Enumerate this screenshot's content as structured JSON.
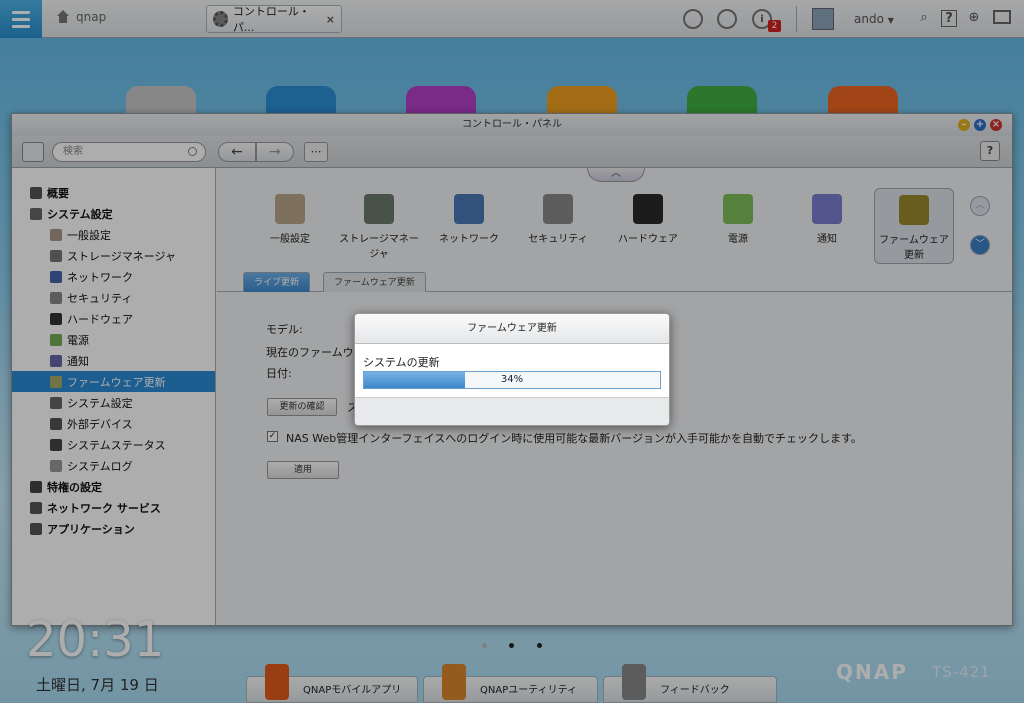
{
  "topbar": {
    "home_label": "qnap",
    "tab_label": "コントロール・パ...",
    "tab_close": "×",
    "info_badge": "2",
    "info_glyph": "i",
    "user": "ando",
    "user_caret": "▼",
    "help_glyph": "?"
  },
  "panel": {
    "title": "コントロール・パネル",
    "search_placeholder": "検索",
    "back": "←",
    "forward": "→",
    "grid": "⋯",
    "help": "?",
    "win_min": "–",
    "win_max": "+",
    "win_close": "×"
  },
  "sidebar": {
    "items": [
      {
        "label": "概要",
        "level": "top",
        "color": "#555"
      },
      {
        "label": "システム設定",
        "level": "top",
        "color": "#666"
      },
      {
        "label": "一般設定",
        "level": "sub",
        "color": "#a98"
      },
      {
        "label": "ストレージマネージャ",
        "level": "sub",
        "color": "#777"
      },
      {
        "label": "ネットワーク",
        "level": "sub",
        "color": "#46a"
      },
      {
        "label": "セキュリティ",
        "level": "sub",
        "color": "#888"
      },
      {
        "label": "ハードウェア",
        "level": "sub",
        "color": "#333"
      },
      {
        "label": "電源",
        "level": "sub",
        "color": "#7a5"
      },
      {
        "label": "通知",
        "level": "sub",
        "color": "#66a"
      },
      {
        "label": "ファームウェア更新",
        "level": "sub",
        "color": "#aa6",
        "active": true
      },
      {
        "label": "システム設定",
        "level": "sub",
        "color": "#666"
      },
      {
        "label": "外部デバイス",
        "level": "sub",
        "color": "#555"
      },
      {
        "label": "システムステータス",
        "level": "sub",
        "color": "#444"
      },
      {
        "label": "システムログ",
        "level": "sub",
        "color": "#999"
      },
      {
        "label": "特権の設定",
        "level": "top",
        "color": "#444"
      },
      {
        "label": "ネットワーク サービス",
        "level": "top",
        "color": "#555"
      },
      {
        "label": "アプリケーション",
        "level": "top",
        "color": "#555"
      }
    ]
  },
  "top_icons": [
    {
      "label": "一般設定",
      "color": "#b8a58a"
    },
    {
      "label": "ストレージマネージャ",
      "color": "#6b7a6b"
    },
    {
      "label": "ネットワーク",
      "color": "#4a7ab5"
    },
    {
      "label": "セキュリティ",
      "color": "#8a8a8a"
    },
    {
      "label": "ハードウェア",
      "color": "#2a2a2a"
    },
    {
      "label": "電源",
      "color": "#7fbf5a"
    },
    {
      "label": "通知",
      "color": "#7a7fd0"
    },
    {
      "label": "ファームウェア更新",
      "color": "#9a8a2a"
    }
  ],
  "collapse_glyph": "︿",
  "scroll_up": "︿",
  "scroll_down": "﹀",
  "tabs": {
    "live": "ライブ更新",
    "firmware": "ファームウェア更新"
  },
  "form": {
    "model_label": "モデル:",
    "current_fw_label": "現在のファームウェア",
    "date_label": "日付:",
    "check_button": "更新の確認",
    "trailing": "ス",
    "auto_check_text": "NAS Web管理インターフェイスへのログイン時に使用可能な最新バージョンが入手可能かを自動でチェックします。",
    "auto_check_checked": true,
    "check_mark": "✓",
    "apply_button": "適用"
  },
  "dialog": {
    "title": "ファームウェア更新",
    "label": "システムの更新",
    "progress": 34,
    "progress_text": "34%"
  },
  "desktop": {
    "time": "20:31",
    "date": "土曜日, 7月 19 日",
    "brand": "QNAP",
    "model": "TS-421",
    "dock": [
      {
        "label": "QNAPモバイルアプリ",
        "color": "#e25a1c"
      },
      {
        "label": "QNAPユーティリティ",
        "color": "#d9862a"
      },
      {
        "label": "フィードバック",
        "color": "#888"
      }
    ]
  }
}
